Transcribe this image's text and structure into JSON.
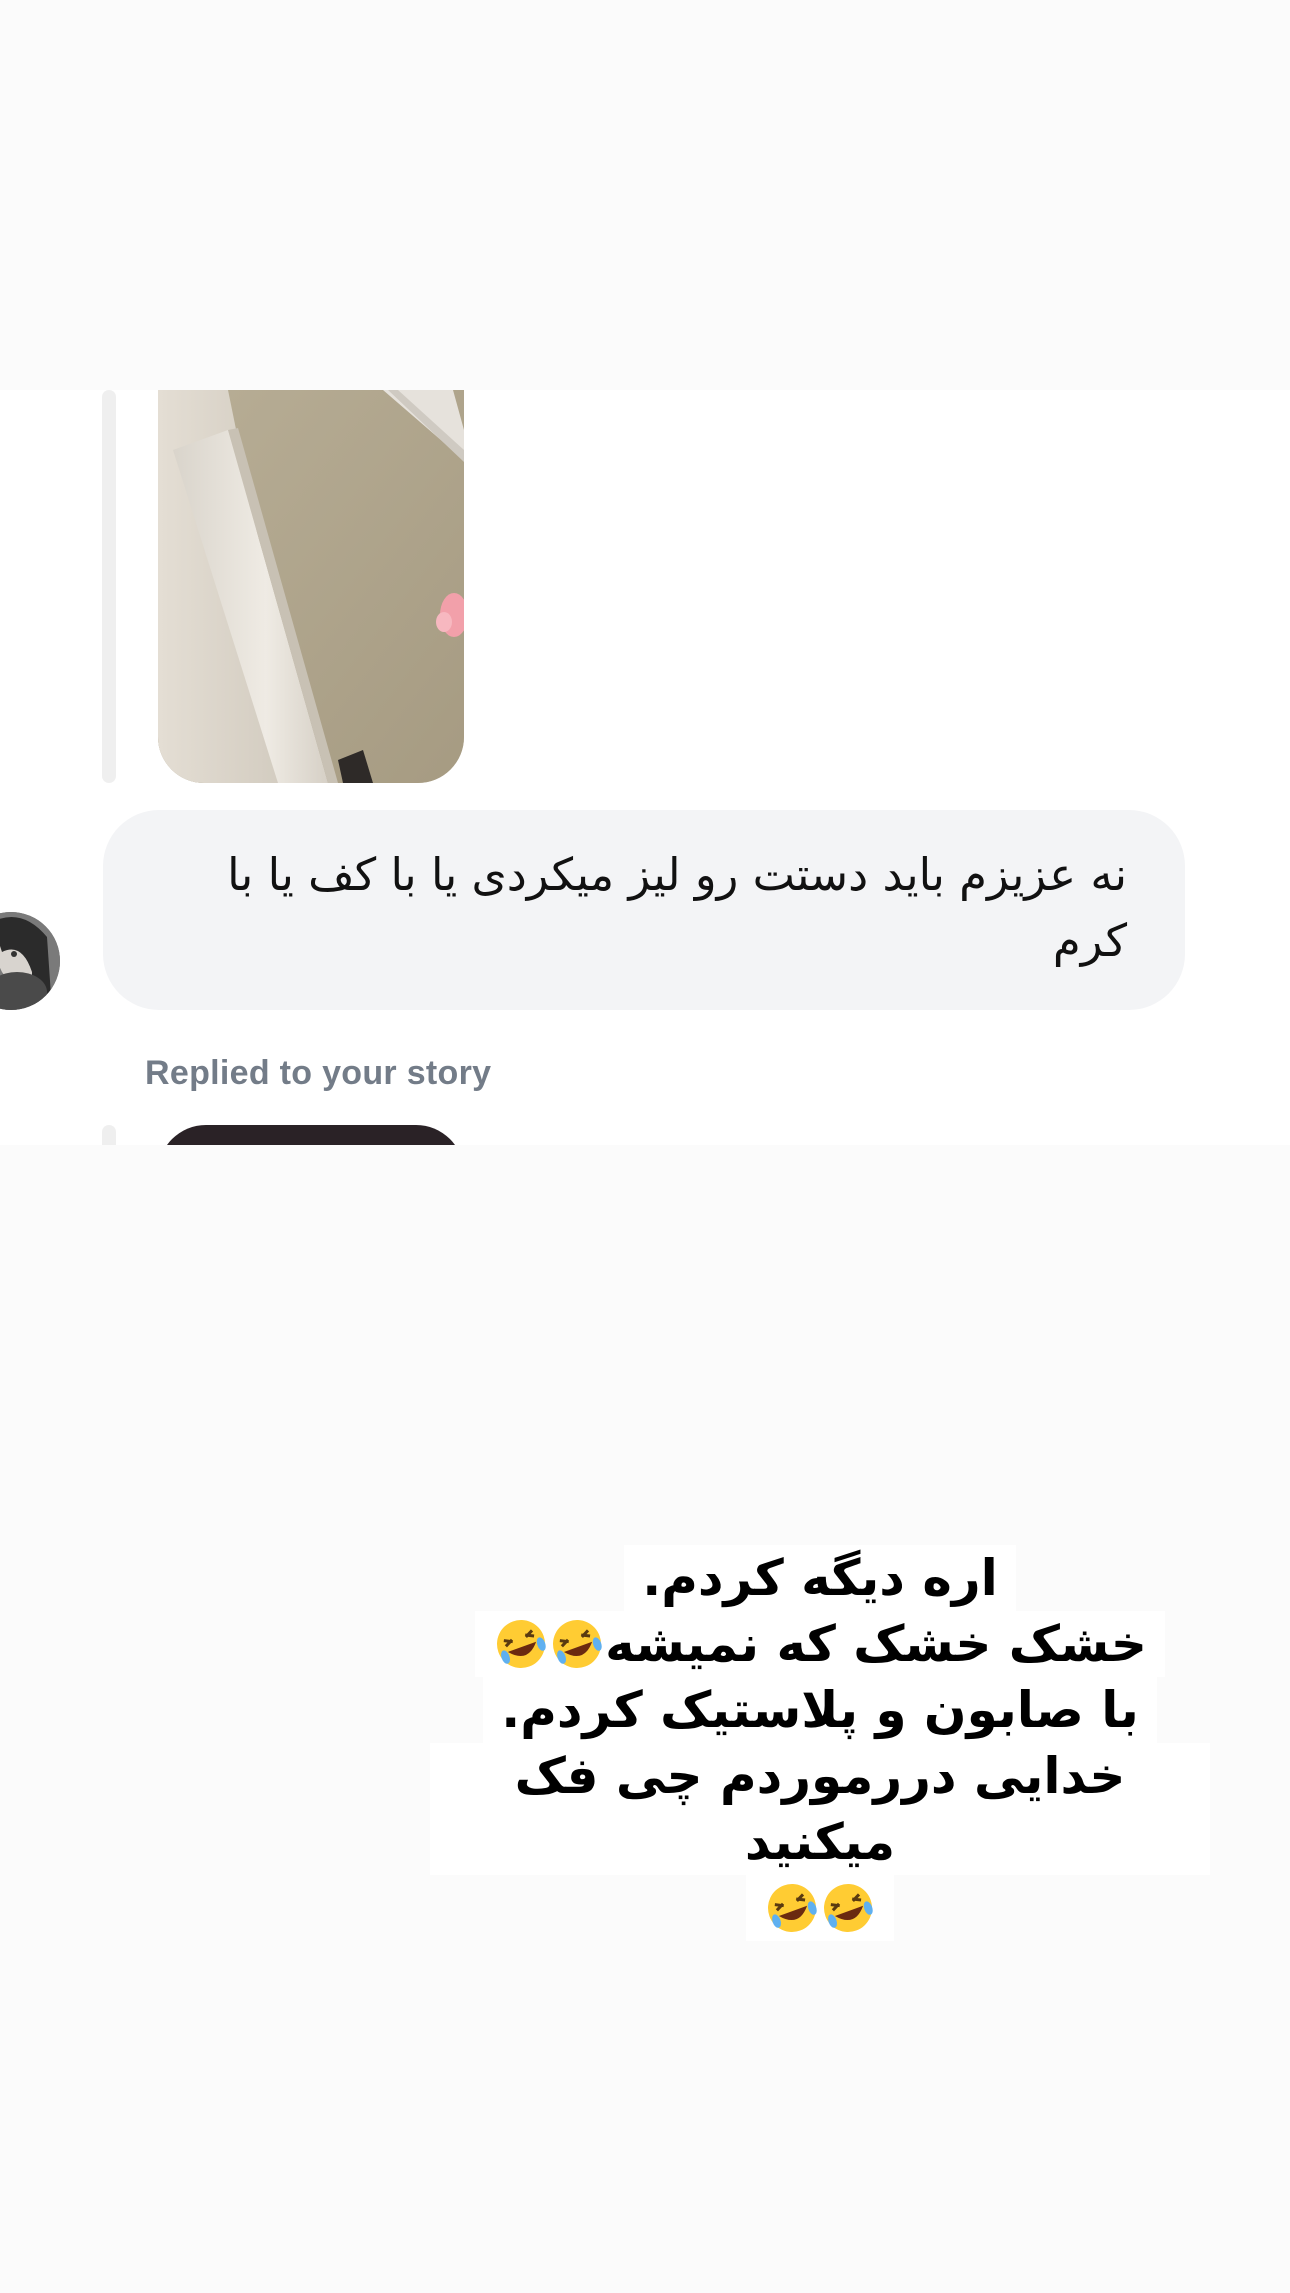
{
  "chat": {
    "message_text": "نه عزیزم باید دستت رو لیز میکردی یا با کف یا با کرم",
    "replied_label": "Replied to your story",
    "story_image_1": "shared-story-image",
    "story_image_2": "shared-story-image",
    "avatar": "sender-avatar"
  },
  "caption": {
    "line1": "اره دیگه کردم.",
    "line2_text": "خشک خشک که نمیشه",
    "line2_emoji": "rolling-on-floor-laughing-emoji x2",
    "line3": "با صابون و پلاستیک کردم.",
    "line4": "خدایی دررموردم چی فک میکنید",
    "line5_emoji": "rolling-on-floor-laughing-emoji x2"
  },
  "colors": {
    "background": "#fbfbfb",
    "chat_background": "#ffffff",
    "bubble": "#f3f4f6",
    "label": "#737c88",
    "reply_bar": "#efefef"
  }
}
